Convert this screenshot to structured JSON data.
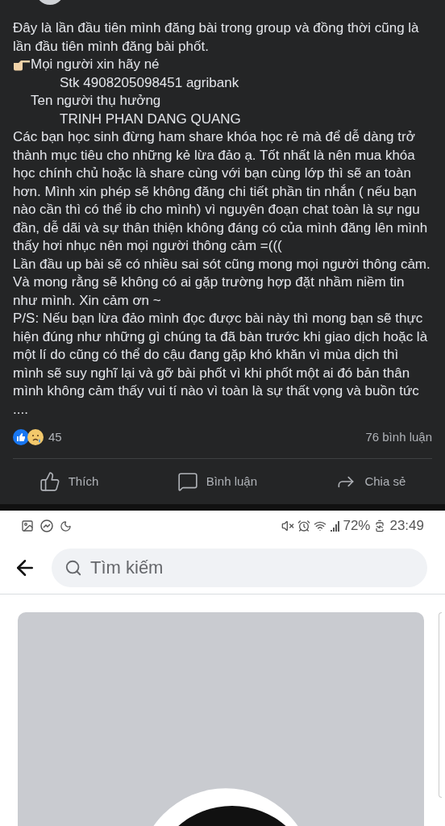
{
  "post": {
    "lines": [
      {
        "kind": "plain",
        "text": "Đây là lần đầu tiên mình đăng bài trong group và đồng thời cũng là lần đầu tiên mình đăng bài phốt."
      },
      {
        "kind": "pointer",
        "text": "Mọi người xin hãy né"
      },
      {
        "kind": "indent_wide",
        "text": "Stk 4908205098451 agribank"
      },
      {
        "kind": "indent_narrow",
        "text": "Ten người thụ hưởng"
      },
      {
        "kind": "indent_wide",
        "text": "TRINH PHAN DANG QUANG"
      },
      {
        "kind": "plain",
        "text": "Các bạn học sinh đừng ham share khóa học rẻ mà để dễ dàng trở thành mục tiêu cho những kẻ lừa đảo ạ. Tốt nhất là nên mua khóa học chính chủ hoặc là share cùng với bạn cùng lớp thì sẽ an toàn hơn. Mình xin phép sẽ không đăng chi tiết phần tin nhắn ( nếu bạn nào cần thì có thể ib cho mình) vì nguyên đoạn chat toàn là sự ngu đần, dễ dãi và sự thân thiện không đáng có của mình đăng lên mình thấy hơi nhục nên mọi người thông cảm =((("
      },
      {
        "kind": "plain",
        "text": "Lần đầu up bài sẽ có nhiều sai sót cũng mong mọi người thông cảm. Và mong rằng sẽ không có ai gặp trường hợp đặt nhầm niềm tin như mình. Xin cảm ơn ~"
      },
      {
        "kind": "plain",
        "text": "P/S: Nếu bạn lừa đảo mình đọc được bài này thì mong bạn sẽ thực hiện đúng như những gì chúng ta đã bàn trước khi giao dịch hoặc là một lí do cũng có thể do cậu đang gặp khó khăn vì mùa dịch thì mình sẽ suy nghĩ lại và gỡ bài phốt vì khi phốt một ai đó bản thân mình không cảm thấy vui tí nào vì toàn là sự thất vọng và buồn tức ...."
      }
    ],
    "reaction_count": "45",
    "comment_count": "76 bình luận",
    "actions": [
      {
        "kind": "like",
        "label": "Thích"
      },
      {
        "kind": "comment",
        "label": "Bình luận"
      },
      {
        "kind": "share",
        "label": "Chia sẻ"
      }
    ]
  },
  "status_bar": {
    "battery": "72%",
    "time": "23:49"
  },
  "search": {
    "placeholder": "Tìm kiếm"
  }
}
